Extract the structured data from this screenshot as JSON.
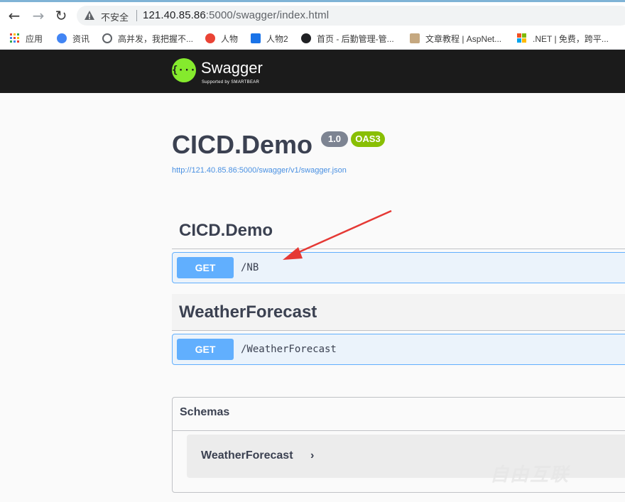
{
  "browser": {
    "address_warning": "不安全",
    "url_host": "121.40.85.86",
    "url_rest": ":5000/swagger/index.html"
  },
  "bookmarks": [
    {
      "label": "应用",
      "color": "#ea4335"
    },
    {
      "label": "资讯",
      "color": "#4285f4"
    },
    {
      "label": "高并发，我把握不...",
      "color": "#5f6368"
    },
    {
      "label": "人物",
      "color": "#ea4335"
    },
    {
      "label": "人物2",
      "color": "#1a73e8"
    },
    {
      "label": "首页 - 后勤管理-管...",
      "color": "#202124"
    },
    {
      "label": "文章教程 | AspNet...",
      "color": "#c5a880"
    },
    {
      "label": ".NET | 免费，跨平...",
      "color": "#f25022"
    }
  ],
  "swagger_header": {
    "logo_glyph": "{···}",
    "brand": "Swagger",
    "sub": "Supported by SMARTBEAR"
  },
  "info": {
    "title": "CICD.Demo",
    "version": "1.0",
    "oas": "OAS3",
    "spec_url": "http://121.40.85.86:5000/swagger/v1/swagger.json"
  },
  "tags": [
    {
      "name": "CICD.Demo",
      "operations": [
        {
          "method": "GET",
          "path": "/NB"
        }
      ]
    },
    {
      "name": "WeatherForecast",
      "operations": [
        {
          "method": "GET",
          "path": "/WeatherForecast"
        }
      ]
    }
  ],
  "schemas": {
    "heading": "Schemas",
    "models": [
      {
        "name": "WeatherForecast",
        "chevron": "›"
      }
    ]
  },
  "annotation": {
    "color": "#e53935"
  },
  "watermark": "自由互联"
}
